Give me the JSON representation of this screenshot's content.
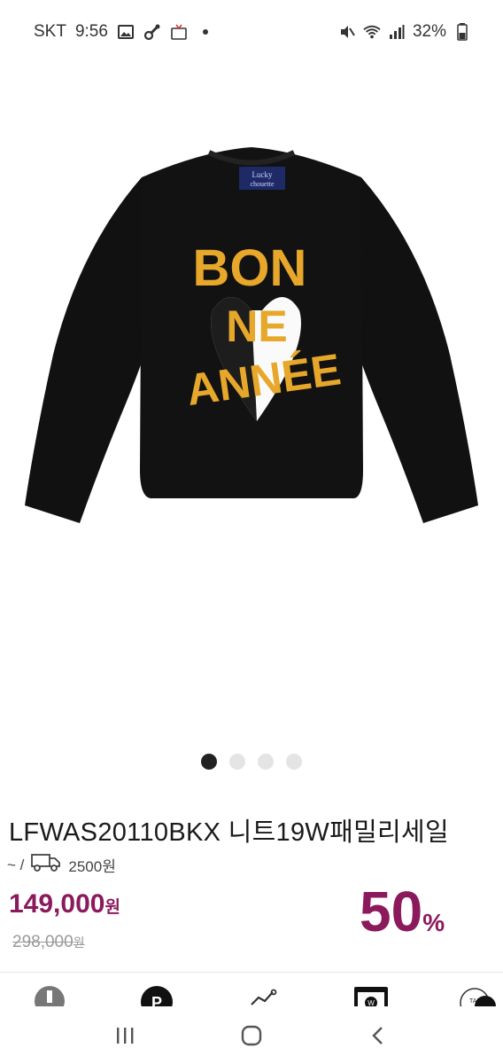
{
  "status_bar": {
    "carrier": "SKT",
    "time": "9:56",
    "battery": "32%"
  },
  "product": {
    "image_label": "sweater-image",
    "graphic_text": [
      "BON",
      "NE",
      "ANNÉE"
    ],
    "brand_label_lines": [
      "Lucky",
      "chouette"
    ],
    "title": "LFWAS20110BKX 니트19W패밀리세일",
    "shipping_prefix": "~ /",
    "shipping_fee": "2500원",
    "price": "149,000",
    "price_unit": "원",
    "original_price": "298,000",
    "original_unit": "원",
    "discount": "50",
    "discount_unit": "%"
  },
  "carousel": {
    "total": 4,
    "active": 1
  },
  "colors": {
    "accent": "#8b1a5c",
    "dark": "#222222"
  }
}
